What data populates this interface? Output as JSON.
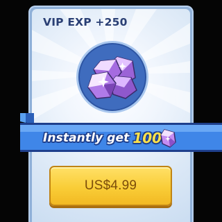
{
  "offer": {
    "vip_exp_label": "VIP EXP +250",
    "item_icon": "purple-crystal-gems-icon",
    "reward_text": "Instantly get",
    "reward_amount": "100",
    "reward_icon": "purple-crystal-icon",
    "price": "US$4.99"
  },
  "colors": {
    "card_border": "#8fb0d8",
    "card_background": "#eaf2fb",
    "title_text": "#2a3f74",
    "circle_fill": "#3f6cbe",
    "ribbon_fill": "#3f86e8",
    "ribbon_outline": "#1e3f8c",
    "amount_text": "#ffe24a",
    "button_fill": "#f9cd37",
    "button_text": "#7c4d0a",
    "gem_color": "#c58cf2"
  }
}
